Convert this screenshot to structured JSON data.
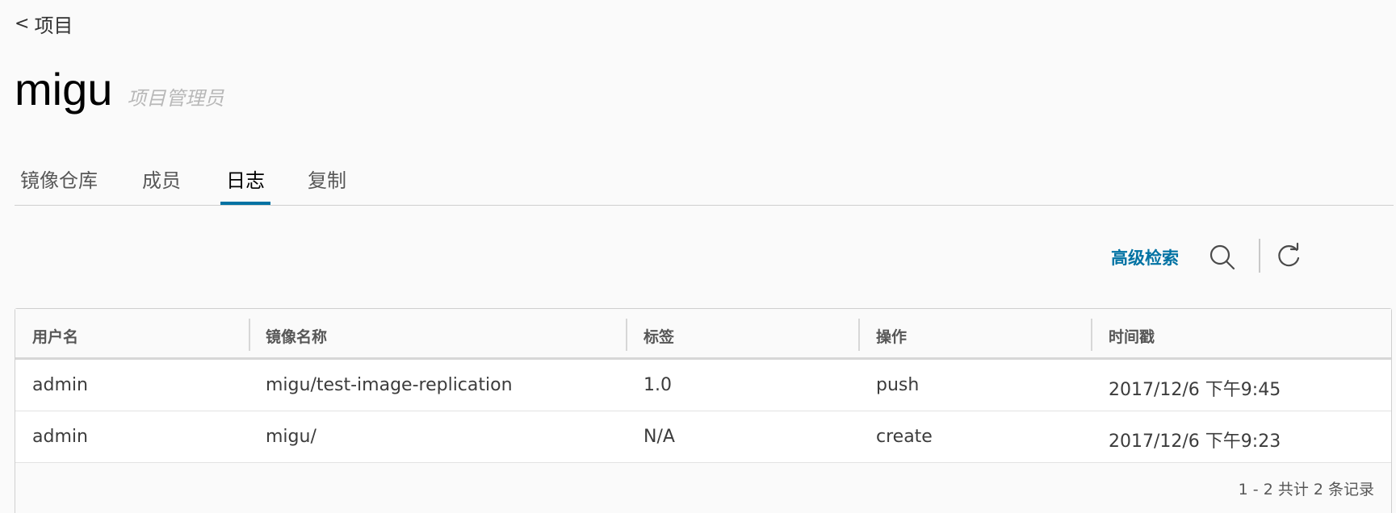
{
  "nav": {
    "back_chevron": "<",
    "back_label": "项目"
  },
  "project": {
    "name": "migu",
    "role": "项目管理员"
  },
  "tabs": [
    {
      "label": "镜像仓库",
      "active": false
    },
    {
      "label": "成员",
      "active": false
    },
    {
      "label": "日志",
      "active": true
    },
    {
      "label": "复制",
      "active": false
    }
  ],
  "toolbar": {
    "advanced_search_label": "高级检索",
    "search_icon": "search-icon",
    "refresh_icon": "refresh-icon"
  },
  "table": {
    "columns": [
      "用户名",
      "镜像名称",
      "标签",
      "操作",
      "时间戳"
    ],
    "rows": [
      [
        "admin",
        "migu/test-image-replication",
        "1.0",
        "push",
        "2017/12/6 下午9:45"
      ],
      [
        "admin",
        "migu/",
        "N/A",
        "create",
        "2017/12/6 下午9:23"
      ]
    ],
    "footer": "1 - 2 共计 2 条记录"
  },
  "colors": {
    "accent": "#0072a3",
    "text": "#313131",
    "muted": "#b8b8b8",
    "background": "#fafafa"
  }
}
